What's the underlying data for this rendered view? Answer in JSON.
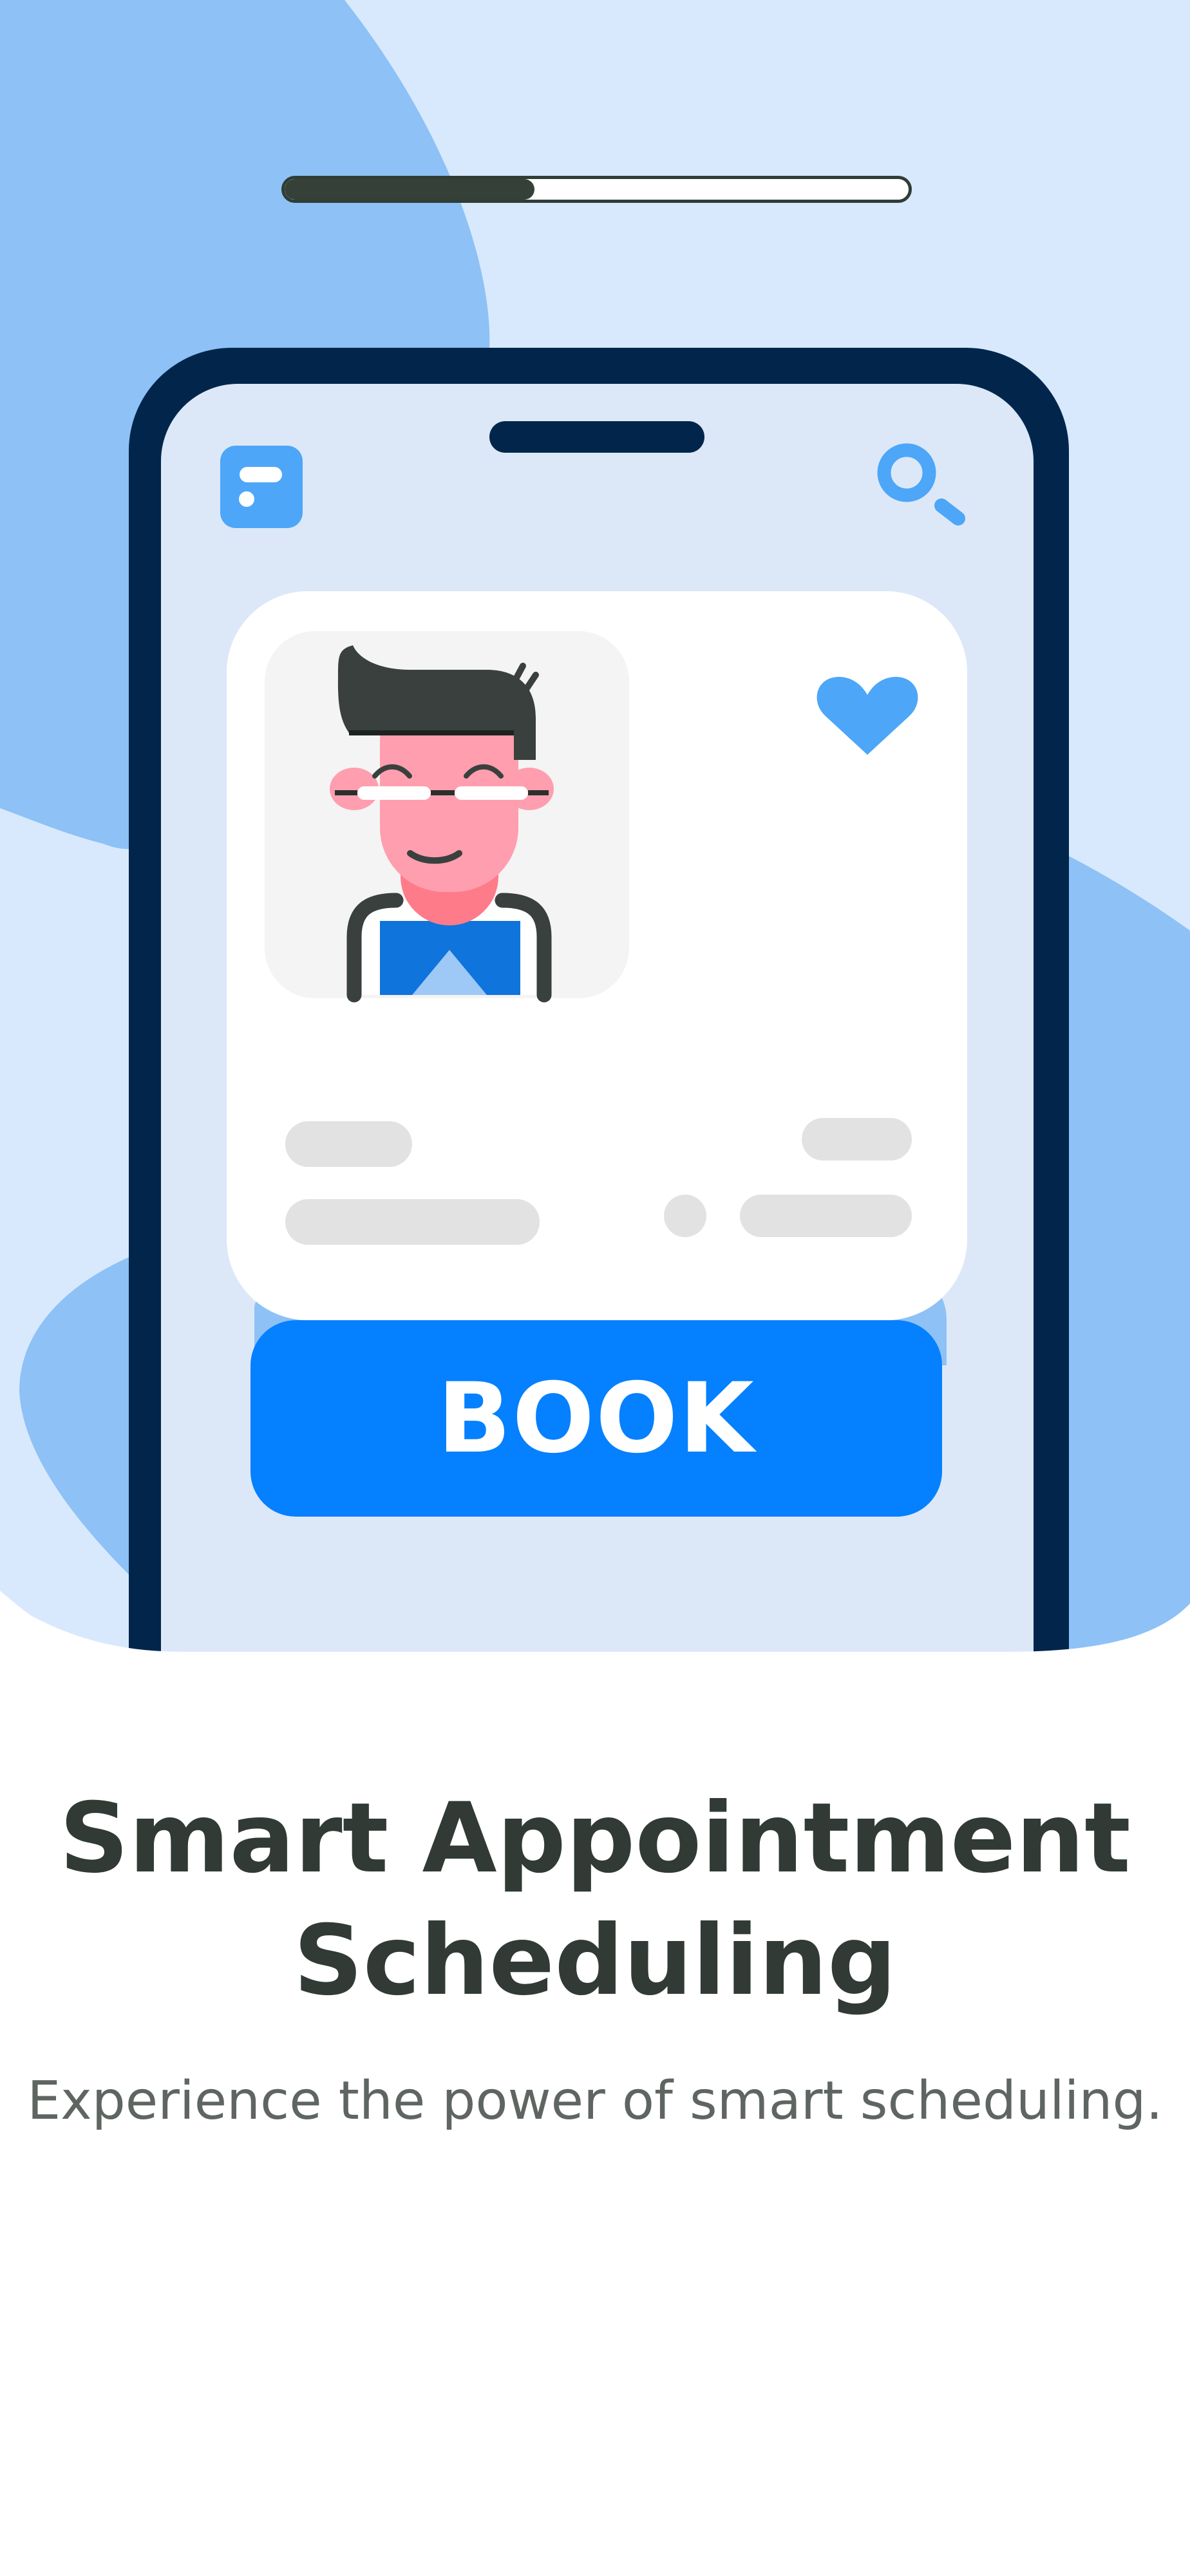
{
  "onboarding": {
    "progress_fraction": 0.4,
    "book_button_label": "BOOK",
    "title": "Smart Appointment Scheduling",
    "subtitle": "Experience the power of smart scheduling."
  },
  "colors": {
    "background": "#ffffff",
    "hero_light_blue": "#d8e9fe",
    "hero_mid_blue": "#8ec1f5",
    "device_frame": "#02264b",
    "device_screen": "#dce8f8",
    "accent_blue": "#0580ff",
    "heart_blue": "#4da6f8",
    "progress_dark": "#344038",
    "title_text": "#313a35",
    "subtitle_text": "#5f6662"
  },
  "icons": {
    "app_logo": "app-logo-icon",
    "search": "search-icon",
    "favorite": "heart-icon",
    "doctor": "doctor-avatar-icon"
  }
}
